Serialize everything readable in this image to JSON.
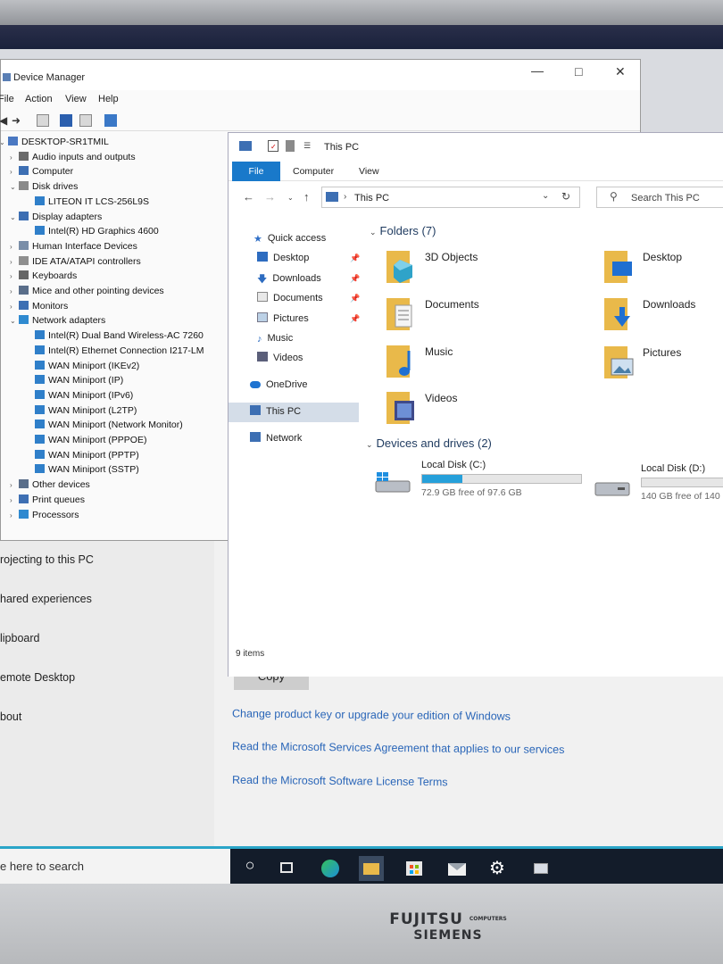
{
  "device_manager": {
    "title": "Device Manager",
    "menu": [
      "File",
      "Action",
      "View",
      "Help"
    ],
    "tree": [
      {
        "label": "DESKTOP-SR1TMIL",
        "level": 0,
        "arrow": "v"
      },
      {
        "label": "Audio inputs and outputs",
        "level": 1,
        "arrow": ">"
      },
      {
        "label": "Computer",
        "level": 1,
        "arrow": ">"
      },
      {
        "label": "Disk drives",
        "level": 1,
        "arrow": "v"
      },
      {
        "label": "LITEON IT LCS-256L9S",
        "level": 2,
        "arrow": ""
      },
      {
        "label": "Display adapters",
        "level": 1,
        "arrow": "v"
      },
      {
        "label": "Intel(R) HD Graphics 4600",
        "level": 2,
        "arrow": ""
      },
      {
        "label": "Human Interface Devices",
        "level": 1,
        "arrow": ">"
      },
      {
        "label": "IDE ATA/ATAPI controllers",
        "level": 1,
        "arrow": ">"
      },
      {
        "label": "Keyboards",
        "level": 1,
        "arrow": ">"
      },
      {
        "label": "Mice and other pointing devices",
        "level": 1,
        "arrow": ">"
      },
      {
        "label": "Monitors",
        "level": 1,
        "arrow": ">"
      },
      {
        "label": "Network adapters",
        "level": 1,
        "arrow": "v"
      },
      {
        "label": "Intel(R) Dual Band Wireless-AC 7260",
        "level": 2,
        "arrow": ""
      },
      {
        "label": "Intel(R) Ethernet Connection I217-LM",
        "level": 2,
        "arrow": ""
      },
      {
        "label": "WAN Miniport (IKEv2)",
        "level": 2,
        "arrow": ""
      },
      {
        "label": "WAN Miniport (IP)",
        "level": 2,
        "arrow": ""
      },
      {
        "label": "WAN Miniport (IPv6)",
        "level": 2,
        "arrow": ""
      },
      {
        "label": "WAN Miniport (L2TP)",
        "level": 2,
        "arrow": ""
      },
      {
        "label": "WAN Miniport (Network Monitor)",
        "level": 2,
        "arrow": ""
      },
      {
        "label": "WAN Miniport (PPPOE)",
        "level": 2,
        "arrow": ""
      },
      {
        "label": "WAN Miniport (PPTP)",
        "level": 2,
        "arrow": ""
      },
      {
        "label": "WAN Miniport (SSTP)",
        "level": 2,
        "arrow": ""
      },
      {
        "label": "Other devices",
        "level": 1,
        "arrow": ">"
      },
      {
        "label": "Print queues",
        "level": 1,
        "arrow": ">"
      },
      {
        "label": "Processors",
        "level": 1,
        "arrow": ">"
      }
    ]
  },
  "explorer": {
    "title": "This PC",
    "ribbon_tabs": [
      "File",
      "Computer",
      "View"
    ],
    "address": "This PC",
    "search_placeholder": "Search This PC",
    "nav": {
      "quick_access": "Quick access",
      "items": [
        {
          "label": "Desktop",
          "pinned": true
        },
        {
          "label": "Downloads",
          "pinned": true
        },
        {
          "label": "Documents",
          "pinned": true
        },
        {
          "label": "Pictures",
          "pinned": true
        },
        {
          "label": "Music",
          "pinned": false
        },
        {
          "label": "Videos",
          "pinned": false
        }
      ],
      "onedrive": "OneDrive",
      "this_pc": "This PC",
      "network": "Network"
    },
    "folders_heading": "Folders (7)",
    "folders": [
      "3D Objects",
      "Desktop",
      "Documents",
      "Downloads",
      "Music",
      "Pictures",
      "Videos"
    ],
    "drives_heading": "Devices and drives (2)",
    "drives": [
      {
        "name": "Local Disk (C:)",
        "free": "72.9 GB free of 97.6 GB",
        "used_fraction": 0.25
      },
      {
        "name": "Local Disk (D:)",
        "free": "140 GB free of 140",
        "used_fraction": 0.0
      }
    ],
    "status": "9 items"
  },
  "settings": {
    "nav": [
      "rojecting to this PC",
      "hared experiences",
      "lipboard",
      "emote Desktop",
      "bout"
    ],
    "copy_button": "Copy",
    "links": [
      "Change product key or upgrade your edition of Windows",
      "Read the Microsoft Services Agreement that applies to our services",
      "Read the Microsoft Software License Terms"
    ]
  },
  "taskbar": {
    "search_text": "e here to search",
    "icons": [
      "task-view-icon",
      "edge-icon",
      "file-explorer-icon",
      "store-icon",
      "mail-icon",
      "settings-icon",
      "device-manager-icon"
    ]
  },
  "monitor": {
    "brand_top": "FUJITSU",
    "brand_small": "COMPUTERS",
    "brand_bottom": "SIEMENS"
  },
  "colors": {
    "accent": "#1979ca",
    "link": "#2a66b8",
    "drive_fill": "#26a0da",
    "folder": "#e9b94a"
  }
}
